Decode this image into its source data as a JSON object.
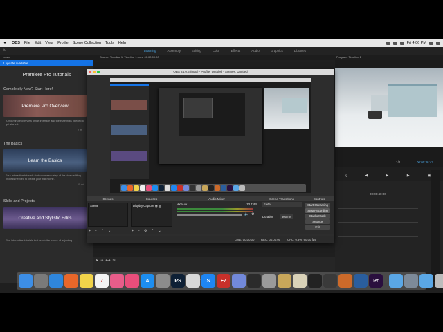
{
  "menubar": {
    "app": "OBS",
    "items": [
      "File",
      "Edit",
      "View",
      "Profile",
      "Scene Collection",
      "Tools",
      "Help"
    ],
    "clock": "Fri 4:06 PM"
  },
  "premiere": {
    "workspaces": [
      "Learning",
      "Assembly",
      "Editing",
      "Color",
      "Effects",
      "Audio",
      "Graphics",
      "Libraries"
    ],
    "active_workspace": "Learning",
    "learn_tab": "Learn",
    "source_label": "Source: Timeline 1: Timeline 1.mov: 00:00:00:00",
    "program_label": "Program: Timeline 1",
    "update_text": "1 update available",
    "panel_title": "Premiere Pro Tutorials",
    "sections": [
      {
        "heading": "Completely New? Start Here!",
        "card": "Premiere Pro Overview",
        "desc": "A two-minute overview of the interface and the essentials needed to get started.",
        "duration": "2 mi"
      },
      {
        "heading": "The Basics",
        "card": "Learn the Basics",
        "desc": "Four interactive tutorials that cover each step of the video editing process needed to create your first movie.",
        "duration": "15 mi"
      },
      {
        "heading": "Skills and Projects",
        "card": "Creative and Stylistic Edits",
        "desc": "Five interactive tutorials that teach the basics of adjusting",
        "duration": ""
      }
    ],
    "program_fit": "1/2",
    "program_timecode": "00:00:36:43",
    "timeline_tc": "00:00:40:00",
    "master": "Master",
    "transport_icons": [
      "mark-in",
      "step-back",
      "play",
      "step-forward",
      "export"
    ]
  },
  "obs": {
    "title": "OBS 24.0.6 (mac) - Profile: Untitled - Scenes: Untitled",
    "docks": {
      "scenes": {
        "header": "Scenes",
        "items": [
          "Scene"
        ]
      },
      "sources": {
        "header": "Sources",
        "items": [
          "Display Capture"
        ]
      },
      "mixer": {
        "header": "Audio Mixer",
        "channel": "Mic/Aux",
        "level": "-13.7 dB"
      },
      "transitions": {
        "header": "Scene Transitions",
        "type": "Fade",
        "duration_label": "Duration",
        "duration_value": "300 ms"
      },
      "controls": {
        "header": "Controls",
        "buttons": [
          "Start Streaming",
          "Stop Recording",
          "Studio Mode",
          "Settings",
          "Exit"
        ]
      }
    },
    "status": {
      "live": "LIVE: 00:00:00",
      "rec": "REC: 00:00:00",
      "cpu": "CPU: 0.3%, 60.00 fps"
    }
  },
  "dock_apps": [
    {
      "name": "finder",
      "label": "",
      "color": "#3d8ee6"
    },
    {
      "name": "launchpad",
      "label": "",
      "color": "#7a7a7a"
    },
    {
      "name": "safari",
      "label": "",
      "color": "#2f86dc"
    },
    {
      "name": "firefox",
      "label": "",
      "color": "#e8672a"
    },
    {
      "name": "notes",
      "label": "",
      "color": "#f1d34a"
    },
    {
      "name": "calendar",
      "label": "7",
      "color": "#f4f4f4"
    },
    {
      "name": "photos",
      "label": "",
      "color": "#e85d8a"
    },
    {
      "name": "itunes",
      "label": "",
      "color": "#e94e7b"
    },
    {
      "name": "app-store",
      "label": "A",
      "color": "#1d8ef0"
    },
    {
      "name": "system-preferences",
      "label": "",
      "color": "#8c8c8c"
    },
    {
      "name": "photoshop",
      "label": "PS",
      "color": "#0e2035"
    },
    {
      "name": "screenflow",
      "label": "",
      "color": "#d8d8d8"
    },
    {
      "name": "shazam",
      "label": "S",
      "color": "#1f86f2"
    },
    {
      "name": "filezilla",
      "label": "FZ",
      "color": "#c7302a"
    },
    {
      "name": "discord",
      "label": "",
      "color": "#7289da"
    },
    {
      "name": "terminal",
      "label": "",
      "color": "#2b2b2b"
    },
    {
      "name": "disk-utility",
      "label": "",
      "color": "#9a9a9a"
    },
    {
      "name": "folder",
      "label": "",
      "color": "#c9a75a"
    },
    {
      "name": "preview",
      "label": "",
      "color": "#d9d2b8"
    },
    {
      "name": "obs",
      "label": "",
      "color": "#222222"
    },
    {
      "name": "piano",
      "label": "",
      "color": "#3a3a3a"
    },
    {
      "name": "handbrake",
      "label": "",
      "color": "#cc6a2a"
    },
    {
      "name": "quicktime",
      "label": "",
      "color": "#2a5e9e"
    },
    {
      "name": "premiere-pro",
      "label": "Pr",
      "color": "#2a0f3e"
    },
    {
      "name": "downloads",
      "label": "",
      "color": "#5aa7e6"
    },
    {
      "name": "screenshot",
      "label": "",
      "color": "#7d8a99"
    },
    {
      "name": "documents",
      "label": "",
      "color": "#5aa7e6"
    },
    {
      "name": "trash",
      "label": "",
      "color": "#bcbcbc"
    }
  ]
}
